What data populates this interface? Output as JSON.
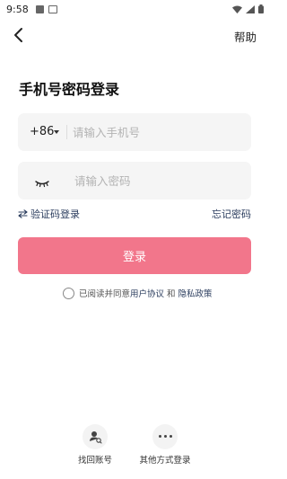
{
  "status_bar": {
    "time": "9:58"
  },
  "header": {
    "help_label": "帮助"
  },
  "page": {
    "title": "手机号密码登录"
  },
  "phone_field": {
    "country_code": "+86",
    "placeholder": "请输入手机号"
  },
  "password_field": {
    "placeholder": "请输入密码"
  },
  "links": {
    "sms_login": "验证码登录",
    "forgot_password": "忘记密码"
  },
  "login_button": {
    "label": "登录",
    "color": "#f2768b"
  },
  "agreement": {
    "prefix": "已阅读并同意",
    "user_agreement": "用户协议",
    "and": "和",
    "privacy_policy": "隐私政策"
  },
  "alt_login": [
    {
      "label": "找回账号",
      "icon": "user-find-icon"
    },
    {
      "label": "其他方式登录",
      "icon": "more-dots-icon"
    }
  ],
  "accent_link_color": "#2b3d5e"
}
